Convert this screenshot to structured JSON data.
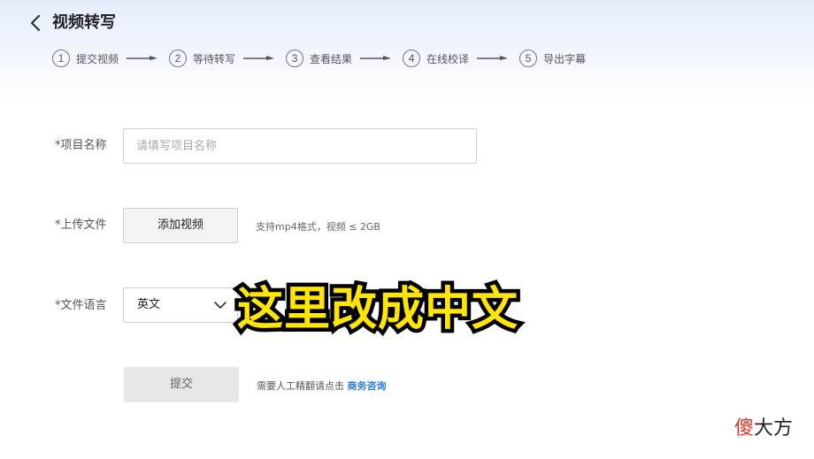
{
  "header": {
    "title": "视频转写",
    "back_icon": "chevron-left-icon"
  },
  "steps": [
    {
      "num": "1",
      "label": "提交视频"
    },
    {
      "num": "2",
      "label": "等待转写"
    },
    {
      "num": "3",
      "label": "查看结果"
    },
    {
      "num": "4",
      "label": "在线校译"
    },
    {
      "num": "5",
      "label": "导出字幕"
    }
  ],
  "form": {
    "project_name": {
      "label": "*项目名称",
      "value": "",
      "placeholder": "请填写项目名称"
    },
    "upload": {
      "label": "*上传文件",
      "button": "添加视频",
      "hint": "支持mp4格式，视频 ≤ 2GB"
    },
    "language": {
      "label": "*文件语言",
      "selected": "英文",
      "icon": "chevron-down-icon"
    },
    "submit": {
      "label": "提交",
      "disabled": true
    },
    "contact": {
      "text": "需要人工精翻请点击 ",
      "link": "商务咨询"
    }
  },
  "overlay": {
    "caption": "这里改成中文",
    "caption_color": "#ffe600",
    "caption_stroke_color": "#000000"
  },
  "watermark": {
    "first": "傻",
    "rest": "大方",
    "first_color": "#e0351f"
  },
  "colors": {
    "link": "#2b7de1",
    "header_gradient_top": "#e4eefb"
  }
}
